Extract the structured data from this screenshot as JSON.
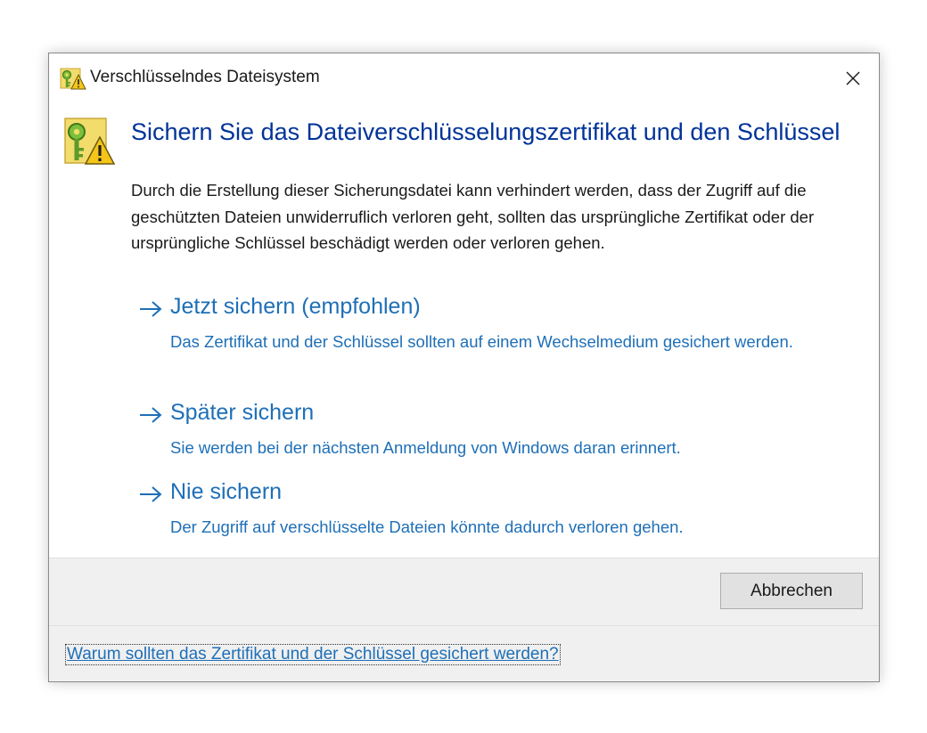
{
  "window": {
    "title": "Verschlüsselndes Dateisystem",
    "close_icon": "close-icon",
    "app_icon": "key-warning-icon"
  },
  "main": {
    "icon": "key-warning-icon",
    "heading": "Sichern Sie das Dateiverschlüsselungszertifikat und den Schlüssel",
    "description": "Durch die Erstellung dieser Sicherungsdatei kann verhindert werden, dass der Zugriff auf die geschützten Dateien unwiderruflich verloren geht, sollten das ursprüngliche Zertifikat oder der ursprüngliche Schlüssel beschädigt werden oder verloren gehen.",
    "options": [
      {
        "title": "Jetzt sichern (empfohlen)",
        "description": "Das Zertifikat und der Schlüssel sollten auf einem Wechselmedium gesichert werden."
      },
      {
        "title": "Später sichern",
        "description": "Sie werden bei der nächsten Anmeldung von Windows daran erinnert."
      },
      {
        "title": "Nie sichern",
        "description": "Der Zugriff auf verschlüsselte Dateien könnte dadurch verloren gehen."
      }
    ]
  },
  "footer": {
    "cancel_label": "Abbrechen"
  },
  "help": {
    "link_text": "Warum sollten das Zertifikat und der Schlüssel gesichert werden?"
  },
  "colors": {
    "heading": "#003399",
    "link": "#1e6fb7",
    "footer_bg": "#f0f0f0"
  }
}
